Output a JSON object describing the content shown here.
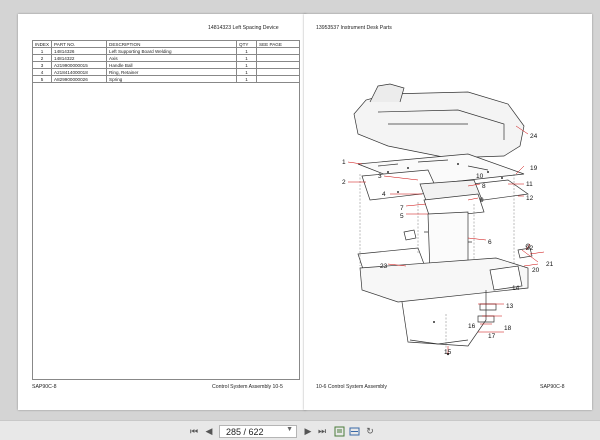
{
  "left_page": {
    "header": "14814323   Left Spacing Device",
    "table": {
      "headers": [
        "INDEX",
        "PART NO.",
        "DESCRIPTION",
        "QTY",
        "SEE PAGE"
      ],
      "rows": [
        [
          "1",
          "14814326",
          "Left Supporting Board Welding",
          "1",
          ""
        ],
        [
          "2",
          "14814322",
          "Axis",
          "1",
          ""
        ],
        [
          "3",
          "A219900000015",
          "Handle Ball",
          "1",
          ""
        ],
        [
          "4",
          "A218414000018",
          "Ring, Retainer",
          "1",
          ""
        ],
        [
          "5",
          "A829900000026",
          "Spring",
          "1",
          ""
        ]
      ]
    },
    "footer_left": "SAP90C-8",
    "footer_right": "Control System Assembly       10-5"
  },
  "right_page": {
    "header": "13953537   Instrument Desk Parts",
    "callouts": [
      "1",
      "2",
      "3",
      "4",
      "5",
      "6",
      "7",
      "8",
      "9",
      "10",
      "11",
      "12",
      "13",
      "14",
      "15",
      "16",
      "17",
      "18",
      "19",
      "20",
      "21",
      "22",
      "23",
      "24"
    ],
    "footer_left": "10-6     Control System Assembly",
    "footer_right": "SAP90C-8"
  },
  "toolbar": {
    "page_current": "285",
    "page_total": "622",
    "page_display": "285 / 622",
    "icons": [
      "first-page-icon",
      "prev-page-icon",
      "next-page-icon",
      "last-page-icon",
      "fit-page-icon",
      "fit-width-icon",
      "rotate-icon"
    ]
  }
}
